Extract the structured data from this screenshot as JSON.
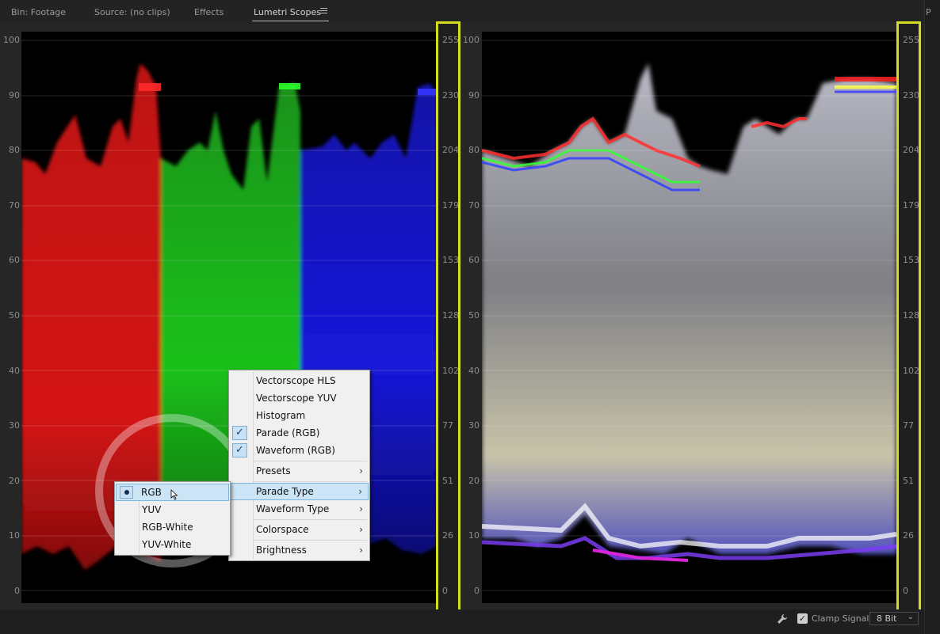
{
  "tabs": [
    {
      "label": "Bin: Footage",
      "active": false
    },
    {
      "label": "Source: (no clips)",
      "active": false
    },
    {
      "label": "Effects",
      "active": false
    },
    {
      "label": "Lumetri Scopes",
      "active": true
    }
  ],
  "edge_panel_label": "P",
  "left_scale": [
    "100",
    "90",
    "80",
    "70",
    "60",
    "50",
    "40",
    "30",
    "20",
    "10",
    "0"
  ],
  "right_scale": [
    "255",
    "230",
    "204",
    "179",
    "153",
    "128",
    "102",
    "77",
    "51",
    "26",
    "0"
  ],
  "scope_types": {
    "parade": "Parade (RGB)",
    "waveform": "Waveform (RGB)"
  },
  "context_menu": {
    "items": [
      {
        "label": "Vectorscope HLS",
        "checked": false,
        "submenu": false
      },
      {
        "label": "Vectorscope YUV",
        "checked": false,
        "submenu": false
      },
      {
        "label": "Histogram",
        "checked": false,
        "submenu": false
      },
      {
        "label": "Parade (RGB)",
        "checked": true,
        "submenu": false
      },
      {
        "label": "Waveform (RGB)",
        "checked": true,
        "submenu": false
      },
      {
        "label": "Presets",
        "checked": false,
        "submenu": true
      },
      {
        "label": "Parade Type",
        "checked": false,
        "submenu": true,
        "highlighted": true
      },
      {
        "label": "Waveform Type",
        "checked": false,
        "submenu": true
      },
      {
        "label": "Colorspace",
        "checked": false,
        "submenu": true
      },
      {
        "label": "Brightness",
        "checked": false,
        "submenu": true
      }
    ],
    "check_glyph": "✓",
    "arrow_glyph": "›"
  },
  "submenu": {
    "items": [
      {
        "label": "RGB",
        "selected": true
      },
      {
        "label": "YUV",
        "selected": false
      },
      {
        "label": "RGB-White",
        "selected": false
      },
      {
        "label": "YUV-White",
        "selected": false
      }
    ]
  },
  "footer": {
    "clamp_label": "Clamp Signal",
    "clamp_checked": true,
    "check_glyph": "✓",
    "bit_depth": "8 Bit",
    "dropdown_glyph": "⌄"
  },
  "colors": {
    "highlight_bar": "#d4dc1f",
    "menu_highlight": "#cce5f6",
    "red": "#e01818",
    "green": "#1fcc1f",
    "blue": "#1a1ae6"
  }
}
